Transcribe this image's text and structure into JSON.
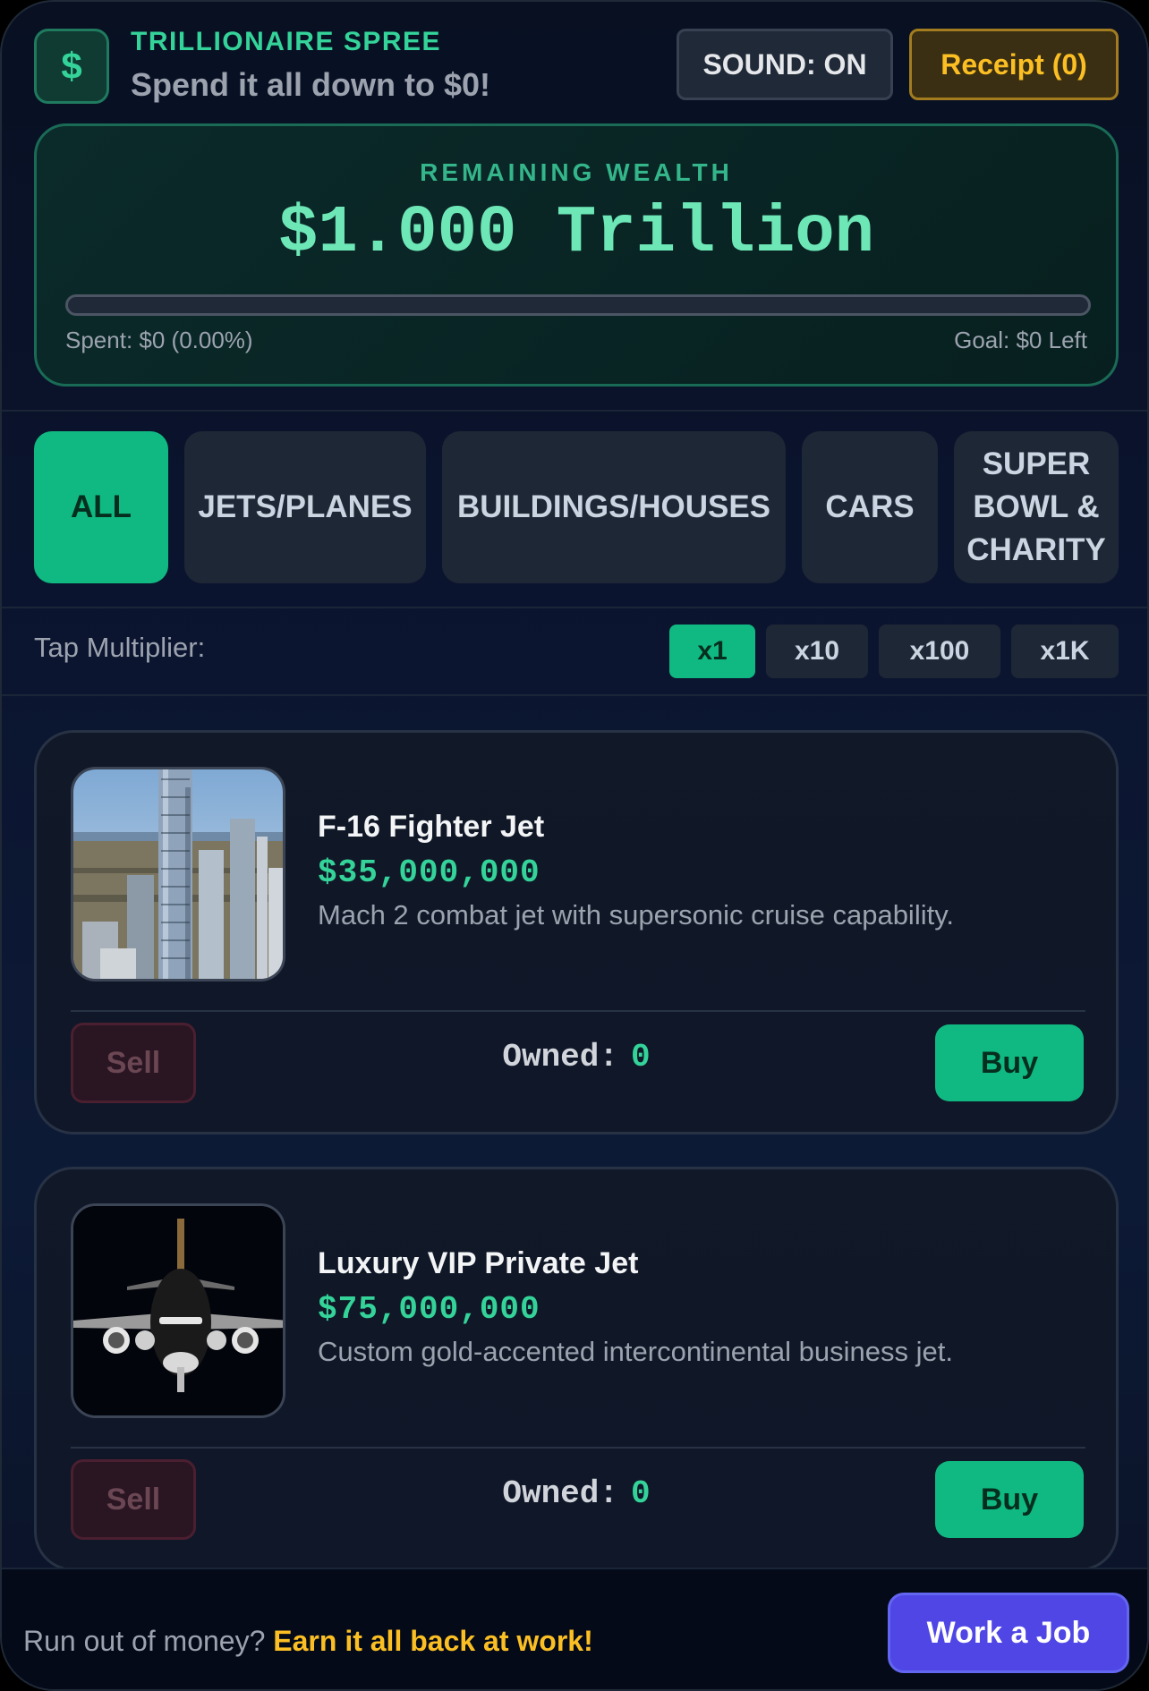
{
  "header": {
    "logo_symbol": "$",
    "title": "TRILLIONAIRE SPREE",
    "subtitle": "Spend it all down to $0!",
    "sound_label": "SOUND: ON",
    "receipt_label": "Receipt (0)"
  },
  "wealth": {
    "label": "REMAINING WEALTH",
    "value": "$1.000 Trillion",
    "spent_percent": 0,
    "spent_text": "Spent: $0 (0.00%)",
    "goal_text": "Goal: $0 Left"
  },
  "tabs": [
    {
      "label": "ALL",
      "active": true
    },
    {
      "label": "JETS/PLANES",
      "active": false
    },
    {
      "label": "BUILDINGS/HOUSES",
      "active": false
    },
    {
      "label": "CARS",
      "active": false
    },
    {
      "label": "SUPER BOWL & CHARITY",
      "active": false
    }
  ],
  "multiplier": {
    "label": "Tap Multiplier:",
    "options": [
      "x1",
      "x10",
      "x100",
      "x1K"
    ],
    "selected": "x1"
  },
  "items": [
    {
      "name": "F-16 Fighter Jet",
      "price": "$35,000,000",
      "description": "Mach 2 combat jet with supersonic cruise capability.",
      "owned_label": "Owned:",
      "owned": "0",
      "sell_label": "Sell",
      "buy_label": "Buy",
      "image": "city-skyline-photo"
    },
    {
      "name": "Luxury VIP Private Jet",
      "price": "$75,000,000",
      "description": "Custom gold-accented intercontinental business jet.",
      "owned_label": "Owned:",
      "owned": "0",
      "sell_label": "Sell",
      "buy_label": "Buy",
      "image": "private-jet-photo"
    }
  ],
  "footer": {
    "prompt": "Run out of money?",
    "highlight": "Earn it all back at work!",
    "job_button": "Work a Job"
  },
  "colors": {
    "accent": "#10b981",
    "accent_text": "#34d399",
    "gold": "#fbbf24",
    "indigo": "#4f46e5"
  }
}
